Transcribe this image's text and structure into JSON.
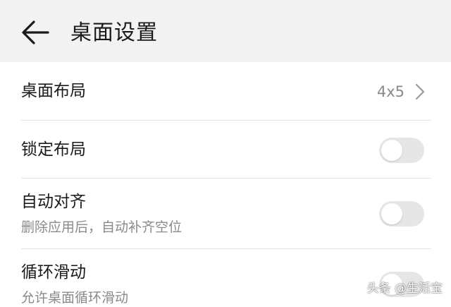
{
  "header": {
    "back_icon": "arrow-left-icon",
    "title": "桌面设置",
    "background": "#f2f2f2"
  },
  "settings": [
    {
      "label": "桌面布局",
      "value": "4x5",
      "control": "chevron-right-icon"
    },
    {
      "label": "锁定布局",
      "control": "toggle",
      "enabled": false
    },
    {
      "label": "自动对齐",
      "sublabel": "删除应用后，自动补齐空位",
      "control": "toggle",
      "enabled": false
    },
    {
      "label": "循环滑动",
      "sublabel": "允许桌面循环滑动",
      "control": "toggle",
      "enabled": false
    }
  ],
  "colors": {
    "toggle_off": "#e6e6e6",
    "secondary_text": "#8a8a8a",
    "divider": "#e3e3e3"
  },
  "watermark": "头条 @生活宝"
}
